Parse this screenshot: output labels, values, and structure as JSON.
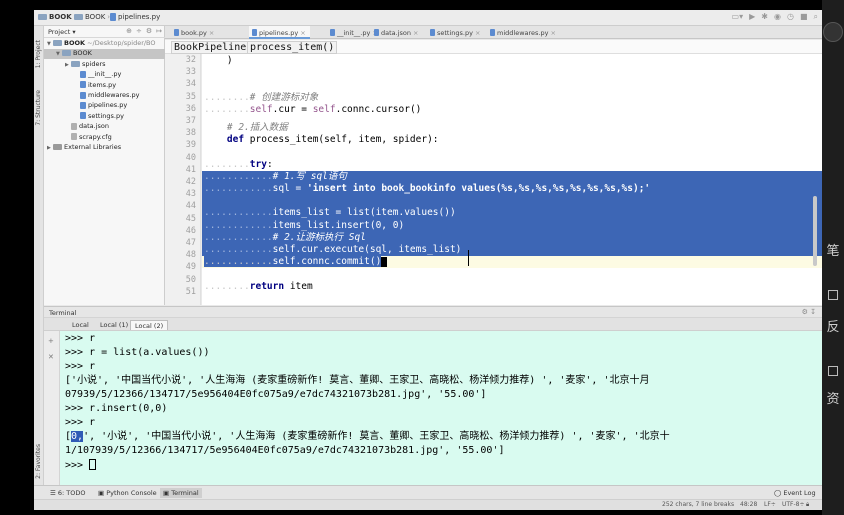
{
  "nav": {
    "crumbs": [
      "BOOK",
      "BOOK",
      "pipelines.py"
    ]
  },
  "project": {
    "selector": "Project",
    "tree": [
      {
        "label": "BOOK",
        "extra": " ~/Desktop/spider/BO",
        "kind": "folder",
        "depth": 0,
        "expanded": true
      },
      {
        "label": "BOOK",
        "extra": "",
        "kind": "folder",
        "depth": 1,
        "expanded": true,
        "selected": true
      },
      {
        "label": "spiders",
        "extra": "",
        "kind": "folder",
        "depth": 2,
        "expanded": false
      },
      {
        "label": "__init__.py",
        "extra": "",
        "kind": "py",
        "depth": 3
      },
      {
        "label": "items.py",
        "extra": "",
        "kind": "py",
        "depth": 3
      },
      {
        "label": "middlewares.py",
        "extra": "",
        "kind": "py",
        "depth": 3
      },
      {
        "label": "pipelines.py",
        "extra": "",
        "kind": "py",
        "depth": 3
      },
      {
        "label": "settings.py",
        "extra": "",
        "kind": "py",
        "depth": 3
      },
      {
        "label": "data.json",
        "extra": "",
        "kind": "json",
        "depth": 2
      },
      {
        "label": "scrapy.cfg",
        "extra": "",
        "kind": "cfg",
        "depth": 2
      },
      {
        "label": "External Libraries",
        "extra": "",
        "kind": "lib",
        "depth": 0,
        "expanded": false
      }
    ]
  },
  "tool_strip": {
    "project": "1: Project",
    "structure": "7: Structure",
    "favorites": "2: Favorites"
  },
  "tabs": [
    {
      "label": "book.py",
      "active": false
    },
    {
      "label": "pipelines.py",
      "active": true
    },
    {
      "label": "__init__.py",
      "active": false
    },
    {
      "label": "data.json",
      "active": false
    },
    {
      "label": "settings.py",
      "active": false
    },
    {
      "label": "middlewares.py",
      "active": false
    }
  ],
  "breadcrumb": {
    "class_name": "BookPipeline",
    "method_name": "process_item()"
  },
  "editor": {
    "line_numbers": [
      "32",
      "33",
      "34",
      "35",
      "36",
      "37",
      "38",
      "39",
      "40",
      "41",
      "42",
      "43",
      "44",
      "45",
      "46",
      "47",
      "48",
      "49",
      "50",
      "51"
    ],
    "lines": {
      "l32": ")",
      "l35_comment": "# 创建游标对象",
      "l36_a": "self",
      "l36_b": ".cur = ",
      "l36_c": "self",
      "l36_d": ".connc.cursor()",
      "l37_comment": "# 2.插入数据",
      "l38_kw": "def ",
      "l38_rest": "process_item(self, item, spider):",
      "l40_kw": "try",
      "l40_rest": ":",
      "l41": "# 1.写 sql语句",
      "l42_a": "sql = ",
      "l42_b": "'insert into book_bookinfo values(%s,%s,%s,%s,%s,%s,%s,%s);'",
      "l44": "items_list = list(item.values())",
      "l45": "items_list.insert(0, 0)",
      "l46": "# 2.让游标执行 Sql",
      "l47": "self.cur.execute(sql, items_list)",
      "l48": "self.connc.commit()",
      "l50_kw": "return ",
      "l50_rest": "item"
    }
  },
  "terminal": {
    "title": "Terminal",
    "tabs": [
      "Local",
      "Local (1)",
      "Local (2)"
    ],
    "active_tab": 2,
    "lines": [
      ">>> r",
      ">>> r = list(a.values())",
      ">>> r",
      "['小说', '中国当代小说', '人生海海 (麦家重磅新作! 莫言、董卿、王家卫、高晓松、杨洋倾力推荐) ', '麦家', '北京十月",
      "07939/5/12366/134717/5e956404E0fc075a9/e7dc74321073b281.jpg', '55.00']",
      ">>> r.insert(0,0)",
      ">>> r",
      "', '小说', '中国当代小说', '人生海海 (麦家重磅新作! 莫言、董卿、王家卫、高晓松、杨洋倾力推荐) ', '麦家', '北京十",
      "1/107939/5/12366/134717/5e956404E0fc075a9/e7dc74321073b281.jpg', '55.00']",
      ">>> "
    ],
    "hl_open": "[",
    "hl_zero": "0,"
  },
  "bottom_tools": {
    "todo": "6: TODO",
    "python_console": "Python Console",
    "terminal": "Terminal",
    "event_log": "Event Log"
  },
  "status": {
    "chars": "252 chars, 7 line breaks",
    "position": "48:28",
    "lf": "LF÷",
    "encoding": "UTF-8÷"
  },
  "right_strip": {
    "glyphs": [
      "笔",
      "反",
      "资"
    ]
  },
  "colors": {
    "selection": "#3d66b5",
    "terminal_bg": "#d9fbf0",
    "keyword": "#000080",
    "string": "#008000",
    "comment": "#808080"
  }
}
